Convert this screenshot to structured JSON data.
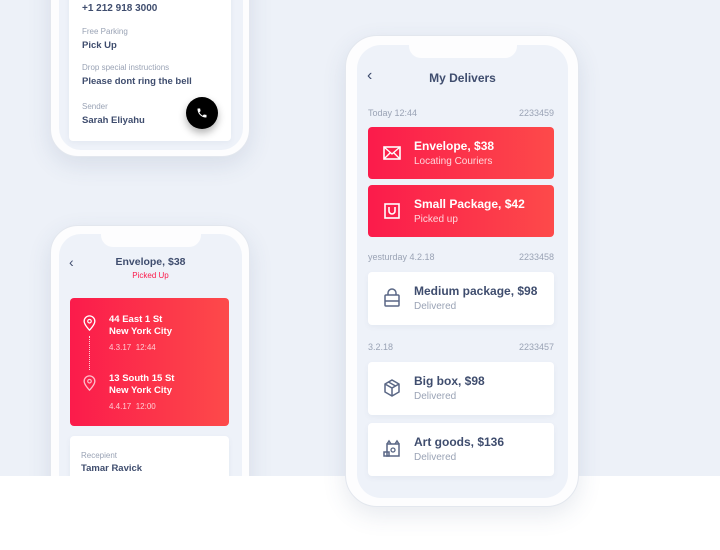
{
  "phone1": {
    "phone": "+1 212 918 3000",
    "parking_label": "Free Parking",
    "parking_value": "Pick Up",
    "instructions_label": "Drop special instructions",
    "instructions_value": "Please dont ring the bell",
    "sender_label": "Sender",
    "sender_value": "Sarah Eliyahu"
  },
  "phone2": {
    "title": "Envelope, $38",
    "status": "Picked Up",
    "from_line1": "44 East 1 St",
    "from_line2": "New York City",
    "from_date": "4.3.17",
    "from_time": "12:44",
    "to_line1": "13 South 15 St",
    "to_line2": "New York City",
    "to_date": "4.4.17",
    "to_time": "12:00",
    "recipient_label": "Recepient",
    "recipient_value": "Tamar Ravick"
  },
  "phone3": {
    "title": "My Delivers",
    "groups": [
      {
        "date": "Today 12:44",
        "id": "2233459"
      },
      {
        "date": "yesturday 4.2.18",
        "id": "2233458"
      },
      {
        "date": "3.2.18",
        "id": "2233457"
      }
    ],
    "items": [
      {
        "title": "Envelope, $38",
        "status": "Locating Couriers",
        "icon": "envelope-icon"
      },
      {
        "title": "Small Package, $42",
        "status": "Picked up",
        "icon": "bag-icon"
      },
      {
        "title": "Medium package, $98",
        "status": "Delivered",
        "icon": "shopping-bag-icon"
      },
      {
        "title": "Big box, $98",
        "status": "Delivered",
        "icon": "box-icon"
      },
      {
        "title": "Art goods, $136",
        "status": "Delivered",
        "icon": "art-icon"
      }
    ]
  },
  "colors": {
    "accent": "#fb1b4b",
    "text": "#3f4d6e",
    "muted": "#9aa3b5",
    "bg": "#edf1f8"
  }
}
